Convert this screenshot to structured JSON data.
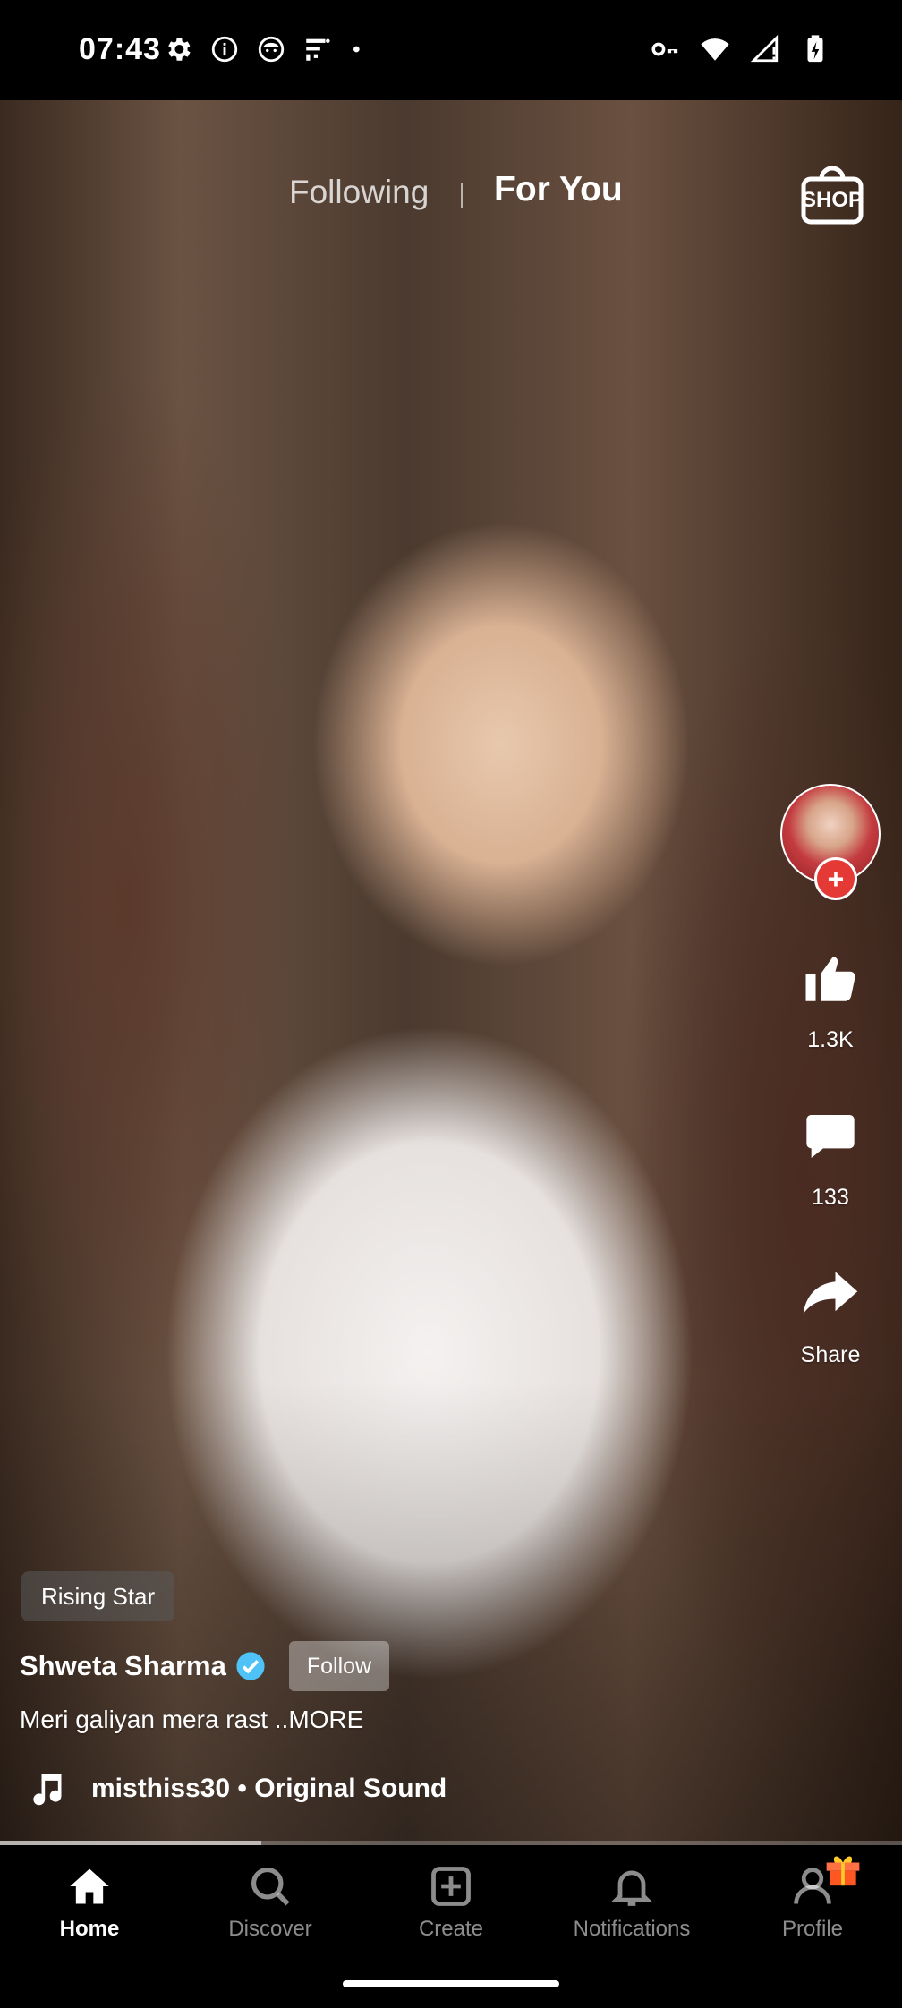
{
  "status_bar": {
    "time": "07:43",
    "left_icons": [
      "settings-icon",
      "info-icon",
      "face-icon",
      "signal-app-icon",
      "dot-icon"
    ],
    "right_icons": [
      "key-icon",
      "wifi-icon",
      "cell-signal-icon",
      "battery-icon"
    ]
  },
  "top_tabs": {
    "following": "Following",
    "for_you": "For You",
    "active": "For You",
    "shop": "SHOP"
  },
  "actions": {
    "likes": "1.3K",
    "comments": "133",
    "share": "Share"
  },
  "post": {
    "badge": "Rising Star",
    "creator": "Shweta Sharma",
    "verified": true,
    "follow_label": "Follow",
    "caption": "Meri galiyan mera rast ..MORE",
    "sound": "misthiss30 • Original Sound",
    "progress_fraction": 0.29
  },
  "bottom_nav": {
    "items": [
      {
        "label": "Home",
        "icon": "home-icon",
        "active": true
      },
      {
        "label": "Discover",
        "icon": "search-icon",
        "active": false
      },
      {
        "label": "Create",
        "icon": "create-icon",
        "active": false
      },
      {
        "label": "Notifications",
        "icon": "bell-icon",
        "active": false
      },
      {
        "label": "Profile",
        "icon": "profile-icon",
        "active": false
      }
    ]
  },
  "colors": {
    "accent_red": "#e53935",
    "verified_blue": "#4fc3f7"
  }
}
